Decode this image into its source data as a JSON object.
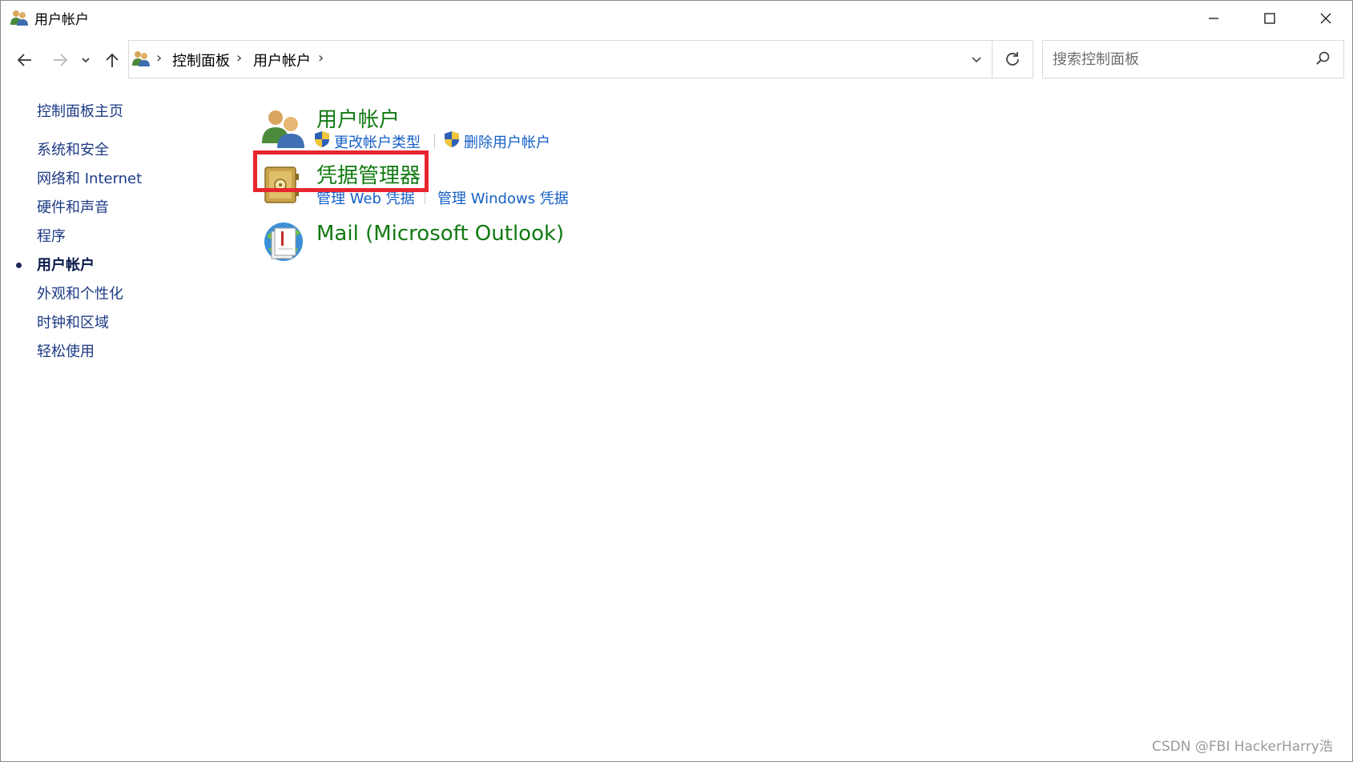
{
  "window": {
    "title": "用户帐户"
  },
  "navbar": {
    "breadcrumbs": [
      "控制面板",
      "用户帐户"
    ],
    "search_placeholder": "搜索控制面板"
  },
  "sidebar": {
    "home": "控制面板主页",
    "items": [
      {
        "label": "系统和安全",
        "active": false
      },
      {
        "label": "网络和 Internet",
        "active": false
      },
      {
        "label": "硬件和声音",
        "active": false
      },
      {
        "label": "程序",
        "active": false
      },
      {
        "label": "用户帐户",
        "active": true
      },
      {
        "label": "外观和个性化",
        "active": false
      },
      {
        "label": "时钟和区域",
        "active": false
      },
      {
        "label": "轻松使用",
        "active": false
      }
    ]
  },
  "categories": [
    {
      "title": "用户帐户",
      "icon": "users-icon",
      "tasks": [
        "更改帐户类型",
        "删除用户帐户"
      ]
    },
    {
      "title": "凭据管理器",
      "icon": "credential-vault-icon",
      "tasks": [
        "管理 Web 凭据",
        "管理 Windows 凭据"
      ]
    },
    {
      "title": "Mail (Microsoft Outlook)",
      "icon": "mail-icon",
      "tasks": []
    }
  ],
  "highlight_color": "#e8242e",
  "link_color": "#1560c7",
  "category_color": "#117a11",
  "watermark": "CSDN @FBI HackerHarry浩"
}
